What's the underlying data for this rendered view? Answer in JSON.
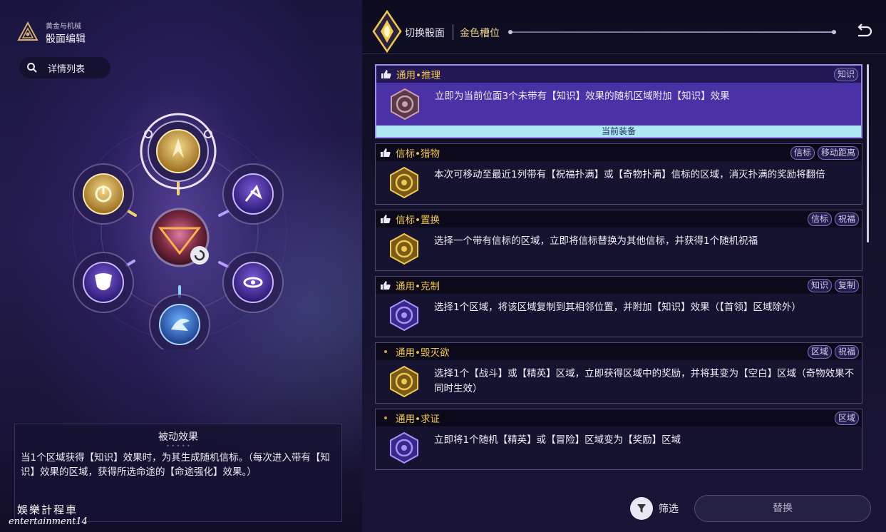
{
  "header": {
    "subtitle": "黄金与机械",
    "title": "骰面编辑",
    "detail_list": "详情列表"
  },
  "top": {
    "switch_face": "切换骰面",
    "slot": "金色槽位"
  },
  "passive": {
    "title": "被动效果",
    "text": "当1个区域获得【知识】效果时，为其生成随机信标。（每次进入带有【知识】效果的区域，获得所选命途的【命途强化】效果。）"
  },
  "cards": [
    {
      "title": "通用•推理",
      "tags": [
        "知识"
      ],
      "text": "立即为当前位面3个未带有【知识】效果的随机区域附加【知识】效果",
      "equipped": "当前装备",
      "mark": "thumb"
    },
    {
      "title": "信标•猎物",
      "tags": [
        "信标",
        "移动距离"
      ],
      "text": "本次可移动至最近1列带有【祝福扑满】或【奇物扑满】信标的区域，消灭扑满的奖励将翻倍",
      "mark": "thumb"
    },
    {
      "title": "信标•置换",
      "tags": [
        "信标",
        "祝福"
      ],
      "text": "选择一个带有信标的区域，立即将信标替换为其他信标，并获得1个随机祝福",
      "mark": "thumb"
    },
    {
      "title": "通用•克制",
      "tags": [
        "知识",
        "复制"
      ],
      "text": "选择1个区域，将该区域复制到其相邻位置，并附加【知识】效果（【首领】区域除外）",
      "mark": "thumb"
    },
    {
      "title": "通用•毁灭欲",
      "tags": [
        "区域",
        "祝福"
      ],
      "text": "选择1个【战斗】或【精英】区域，立即获得区域中的奖励，并将其变为【空白】区域（奇物效果不同时生效）",
      "mark": "dot"
    },
    {
      "title": "通用•求证",
      "tags": [
        "区域"
      ],
      "text": "立即将1个随机【精英】或【冒险】区域变为【奖励】区域",
      "mark": "dot"
    }
  ],
  "bottom": {
    "filter": "筛选",
    "replace": "替换"
  },
  "watermark": {
    "line1": "娛樂計程車",
    "line2": "entertainment14"
  },
  "icons": [
    "brand-triangle-icon",
    "search-icon",
    "back-arrow-icon",
    "filter-icon",
    "thumbs-up-icon",
    "slot-gem-icon"
  ],
  "colors": {
    "accent_gold": "#f2c84b",
    "selected_card": "#4b31a6",
    "equip_bar": "#aee8f5"
  }
}
